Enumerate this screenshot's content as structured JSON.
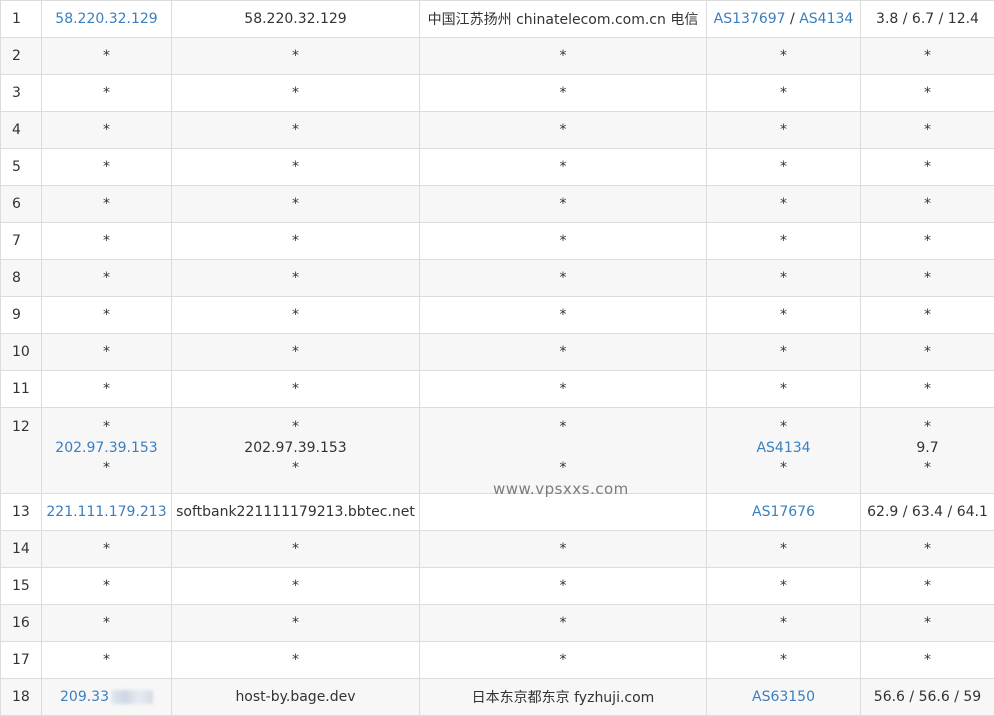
{
  "watermark": "www.vpsxxs.com",
  "rows": [
    {
      "hop": "1",
      "ip": "58.220.32.129",
      "host": "58.220.32.129",
      "loc": "中国江苏扬州 chinatelecom.com.cn 电信",
      "as1": "AS137697",
      "as_sep": " / ",
      "as2": "AS4134",
      "rtt": "3.8 / 6.7 / 12.4"
    },
    {
      "hop": "2",
      "ip": "*",
      "host": "*",
      "loc": "*",
      "as": "*",
      "rtt": "*"
    },
    {
      "hop": "3",
      "ip": "*",
      "host": "*",
      "loc": "*",
      "as": "*",
      "rtt": "*"
    },
    {
      "hop": "4",
      "ip": "*",
      "host": "*",
      "loc": "*",
      "as": "*",
      "rtt": "*"
    },
    {
      "hop": "5",
      "ip": "*",
      "host": "*",
      "loc": "*",
      "as": "*",
      "rtt": "*"
    },
    {
      "hop": "6",
      "ip": "*",
      "host": "*",
      "loc": "*",
      "as": "*",
      "rtt": "*"
    },
    {
      "hop": "7",
      "ip": "*",
      "host": "*",
      "loc": "*",
      "as": "*",
      "rtt": "*"
    },
    {
      "hop": "8",
      "ip": "*",
      "host": "*",
      "loc": "*",
      "as": "*",
      "rtt": "*"
    },
    {
      "hop": "9",
      "ip": "*",
      "host": "*",
      "loc": "*",
      "as": "*",
      "rtt": "*"
    },
    {
      "hop": "10",
      "ip": "*",
      "host": "*",
      "loc": "*",
      "as": "*",
      "rtt": "*"
    },
    {
      "hop": "11",
      "ip": "*",
      "host": "*",
      "loc": "*",
      "as": "*",
      "rtt": "*"
    },
    {
      "hop": "12",
      "ip": [
        "*",
        "202.97.39.153",
        "*"
      ],
      "host": [
        "*",
        "202.97.39.153",
        "*"
      ],
      "loc": [
        "*",
        "",
        "*"
      ],
      "as": [
        "*",
        "AS4134",
        "*"
      ],
      "rtt": [
        "*",
        "9.7",
        "*"
      ]
    },
    {
      "hop": "13",
      "ip": "221.111.179.213",
      "host": "softbank221111179213.bbtec.net",
      "loc": "",
      "as": "AS17676",
      "rtt": "62.9 / 63.4 / 64.1"
    },
    {
      "hop": "14",
      "ip": "*",
      "host": "*",
      "loc": "*",
      "as": "*",
      "rtt": "*"
    },
    {
      "hop": "15",
      "ip": "*",
      "host": "*",
      "loc": "*",
      "as": "*",
      "rtt": "*"
    },
    {
      "hop": "16",
      "ip": "*",
      "host": "*",
      "loc": "*",
      "as": "*",
      "rtt": "*"
    },
    {
      "hop": "17",
      "ip": "*",
      "host": "*",
      "loc": "*",
      "as": "*",
      "rtt": "*"
    },
    {
      "hop": "18",
      "ip": "209.33",
      "host": "host-by.bage.dev",
      "loc": "日本东京都东京 fyzhuji.com",
      "as": "AS63150",
      "rtt": "56.6 / 56.6 / 59"
    }
  ]
}
